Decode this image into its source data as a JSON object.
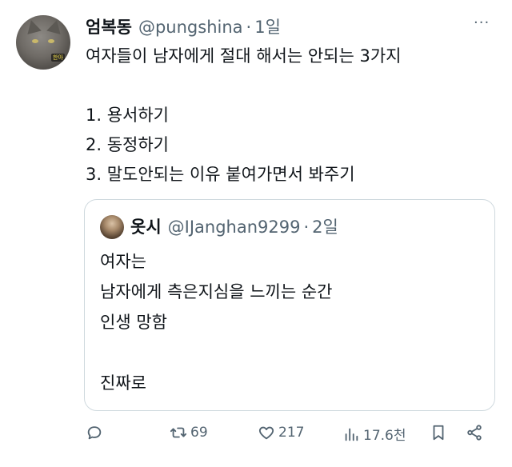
{
  "tweet": {
    "author_name": "엄복동",
    "author_handle": "@pungshina",
    "separator": "·",
    "time": "1일",
    "more_label": "···",
    "avatar_tag": "한아",
    "lines": [
      "여자들이 남자에게 절대 해서는 안되는 3가지",
      "",
      "1. 용서하기",
      "2. 동정하기",
      "3. 말도안되는 이유 붙여가면서 봐주기"
    ]
  },
  "quoted": {
    "author_name": "옷시",
    "author_handle": "@IJanghan9299",
    "separator": "·",
    "time": "2일",
    "lines": [
      "여자는",
      "남자에게 측은지심을 느끼는 순간",
      "인생 망함",
      "",
      "진짜로"
    ]
  },
  "actions": {
    "reply_count": "",
    "retweet_count": "69",
    "like_count": "217",
    "views_count": "17.6천"
  },
  "icons": {
    "reply": "reply-icon",
    "retweet": "retweet-icon",
    "like": "heart-icon",
    "views": "views-icon",
    "bookmark": "bookmark-icon",
    "share": "share-icon"
  },
  "colors": {
    "text": "#0f1419",
    "muted": "#536471",
    "border": "#cfd9de"
  }
}
